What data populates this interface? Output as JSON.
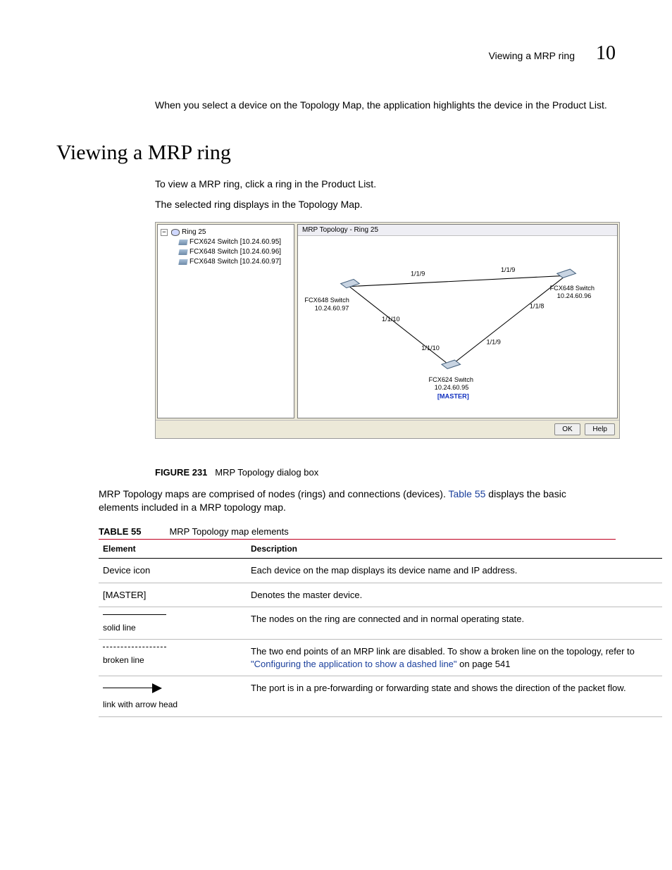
{
  "header": {
    "running": "Viewing a MRP ring",
    "chapter": "10"
  },
  "intro": "When you select a device on the Topology Map, the application highlights the device in the Product List.",
  "section_title": "Viewing a MRP ring",
  "p1": "To view a MRP ring, click a ring in the Product List.",
  "p2": "The selected ring displays in the Topology Map.",
  "dialog": {
    "ring_label": "Ring 25",
    "dev1": "FCX624 Switch [10.24.60.95]",
    "dev2": "FCX648 Switch [10.24.60.96]",
    "dev3": "FCX648 Switch [10.24.60.97]",
    "map_title": "MRP Topology - Ring 25",
    "nodeA_name": "FCX648 Switch",
    "nodeA_ip": "10.24.60.97",
    "nodeB_name": "FCX648 Switch",
    "nodeB_ip": "10.24.60.96",
    "nodeC_name": "FCX624 Switch",
    "nodeC_ip": "10.24.60.95",
    "nodeC_tag": "[MASTER]",
    "link1a": "1/1/9",
    "link1b": "1/1/9",
    "link2a": "1/1/10",
    "link2b": "1/1/8",
    "link3a": "1/1/10",
    "link3b": "1/1/9",
    "btn_ok": "OK",
    "btn_help": "Help"
  },
  "fig_label": "FIGURE 231",
  "fig_title": "MRP Topology dialog box",
  "after_fig_a": "MRP Topology maps are comprised of nodes (rings) and connections (devices). ",
  "after_fig_link": "Table 55",
  "after_fig_b": " displays the basic elements included in a MRP topology map.",
  "table": {
    "label": "TABLE 55",
    "title": "MRP Topology map elements",
    "h1": "Element",
    "h2": "Description",
    "rows": [
      {
        "elem": "Device icon",
        "desc": "Each device on the map displays its device name and IP address."
      },
      {
        "elem": "[MASTER]",
        "desc": "Denotes the master device."
      },
      {
        "elem_sub": "solid line",
        "desc": "The nodes on the ring are connected and in normal operating state."
      },
      {
        "elem_sub": "broken line",
        "desc_a": "The two end points of an MRP link are disabled. To show a broken line on the topology, refer to ",
        "desc_link": "\"Configuring the application to show a dashed line\"",
        "desc_b": " on page 541"
      },
      {
        "elem_sub": "link with arrow head",
        "desc": "The port is in a pre-forwarding or forwarding state and shows the direction of the packet flow."
      }
    ]
  }
}
